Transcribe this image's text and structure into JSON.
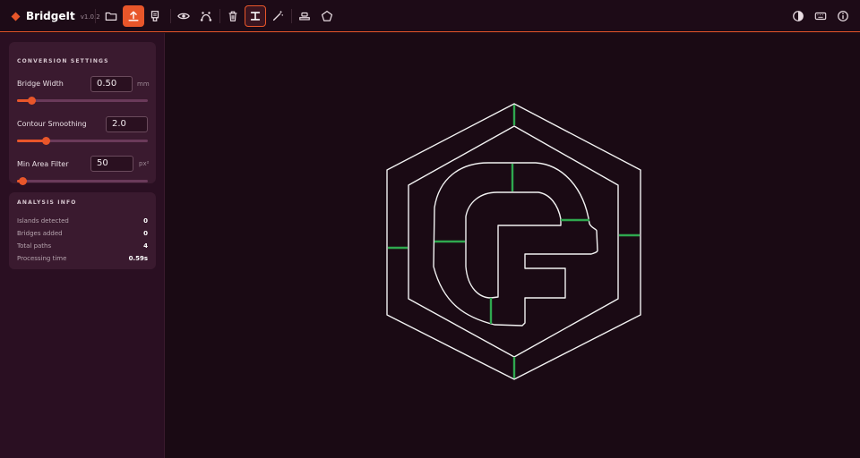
{
  "app": {
    "name": "BridgeIt",
    "version": "v1.0.2",
    "accent": "#e8562a",
    "bridge_color": "#2fa84f"
  },
  "toolbar": {
    "groups": [
      [
        "folder-open-icon",
        "upload-icon",
        "save-icon"
      ],
      [
        "eye-icon",
        "path-nodes-icon"
      ],
      [
        "trash-icon",
        "bridge-tool-icon",
        "magic-wand-icon"
      ],
      [
        "stamp-icon",
        "polygon-icon"
      ]
    ],
    "active": "upload-icon",
    "selected": "bridge-tool-icon",
    "right": [
      "contrast-icon",
      "keyboard-icon",
      "info-icon"
    ]
  },
  "settings": {
    "title": "CONVERSION SETTINGS",
    "bridge_width": {
      "label": "Bridge Width",
      "value": "0.50",
      "unit": "mm",
      "slider": 0.11
    },
    "contour_smoothing": {
      "label": "Contour Smoothing",
      "value": "2.0",
      "slider": 0.22
    },
    "min_area": {
      "label": "Min Area Filter",
      "value": "50",
      "unit": "px²",
      "slider": 0.04
    }
  },
  "analysis": {
    "title": "ANALYSIS INFO",
    "rows": [
      {
        "label": "Islands detected",
        "value": "0"
      },
      {
        "label": "Bridges added",
        "value": "0"
      },
      {
        "label": "Total paths",
        "value": "4"
      },
      {
        "label": "Processing time",
        "value": "0.59s"
      }
    ]
  }
}
